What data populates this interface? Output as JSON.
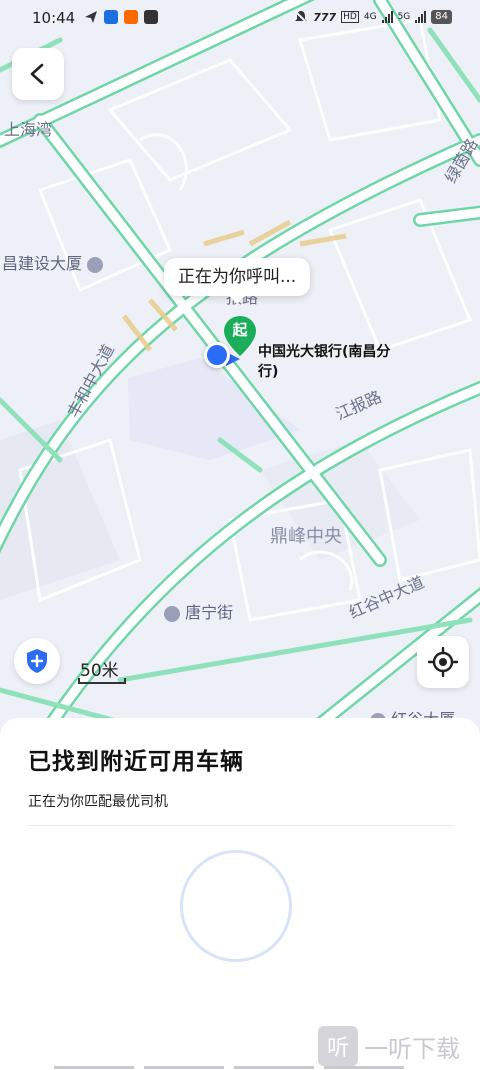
{
  "status_bar": {
    "time": "10:44",
    "battery": "84",
    "network_labels": [
      "HD",
      "4G",
      "5G"
    ]
  },
  "map": {
    "callout": "正在为你呼叫...",
    "start_pin_label": "起",
    "place_name": "中国光大银行(南昌分行)",
    "scale": "50米",
    "pois": [
      {
        "name": "昌建设大厦"
      },
      {
        "name": "唐宁街"
      },
      {
        "name": "鼎峰中央"
      },
      {
        "name": "红谷大厦"
      }
    ],
    "roads": [
      {
        "name": "丰和中大道"
      },
      {
        "name": "江报路"
      },
      {
        "name": "红谷中大道"
      },
      {
        "name": "绿茵路"
      },
      {
        "name": "上海湾"
      },
      {
        "name": "报路"
      }
    ]
  },
  "sheet": {
    "title": "已找到附近可用车辆",
    "subtitle": "正在为你匹配最优司机"
  },
  "watermark": {
    "glyph": "听",
    "text": "一听下载"
  },
  "colors": {
    "road_green": "#6fd6a8",
    "map_bg": "#eef0f7",
    "accent_blue": "#2a6cf6",
    "pin_green": "#1aad5a"
  }
}
